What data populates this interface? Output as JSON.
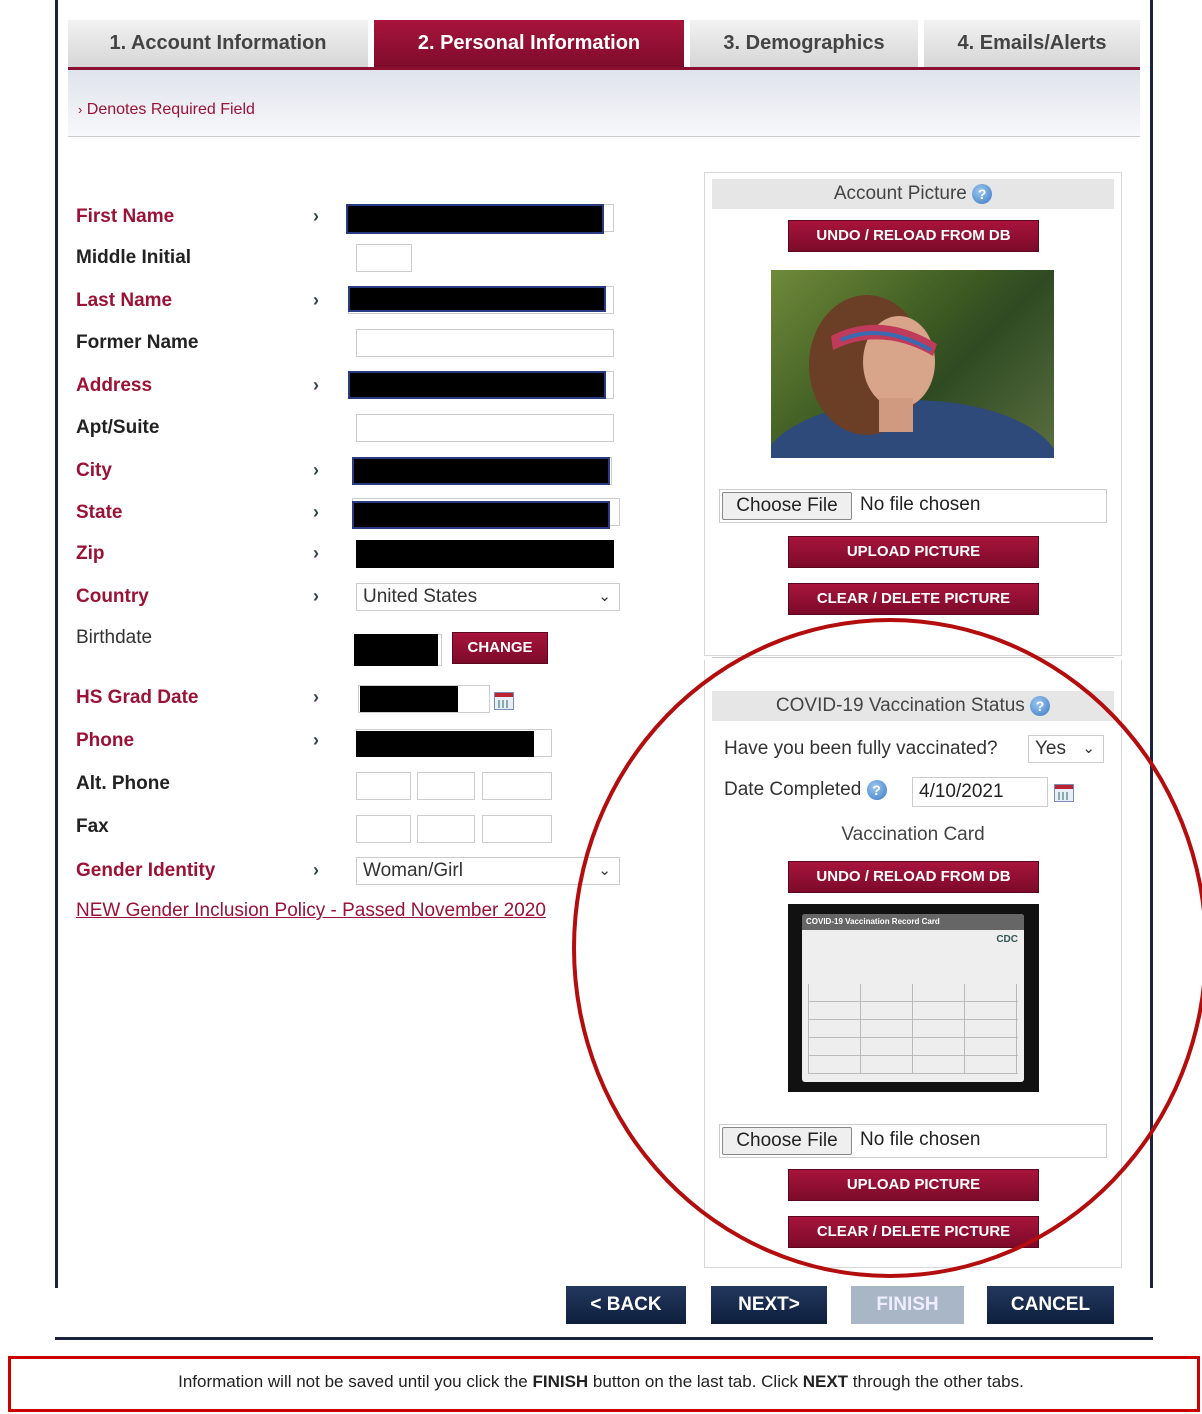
{
  "tabs": [
    {
      "label": "1. Account Information"
    },
    {
      "label": "2. Personal Information"
    },
    {
      "label": "3. Demographics"
    },
    {
      "label": "4. Emails/Alerts"
    }
  ],
  "required_note": "Denotes Required Field",
  "form": {
    "first_name": "First Name",
    "middle_initial": "Middle Initial",
    "last_name": "Last Name",
    "former_name": "Former Name",
    "address": "Address",
    "apt_suite": "Apt/Suite",
    "city": "City",
    "state": "State",
    "zip": "Zip",
    "country": "Country",
    "country_value": "United States",
    "birthdate": "Birthdate",
    "change_label": "CHANGE",
    "hs_grad_date": "HS Grad Date",
    "phone": "Phone",
    "alt_phone": "Alt. Phone",
    "fax": "Fax",
    "gender_identity": "Gender Identity",
    "gender_value": "Woman/Girl",
    "policy_link": "NEW Gender Inclusion Policy - Passed November 2020"
  },
  "account_picture": {
    "title": "Account Picture",
    "undo_label": "UNDO / RELOAD FROM DB",
    "choose_file": "Choose File",
    "no_file": "No file chosen",
    "upload_label": "UPLOAD PICTURE",
    "clear_label": "CLEAR / DELETE PICTURE"
  },
  "vaccination": {
    "title": "COVID-19 Vaccination Status",
    "question": "Have you been fully vaccinated?",
    "answer": "Yes",
    "date_label": "Date Completed",
    "date_value": "4/10/2021",
    "card_label": "Vaccination Card",
    "undo_label": "UNDO / RELOAD FROM DB",
    "card_image_title": "COVID-19 Vaccination Record Card",
    "card_logo": "CDC",
    "choose_file": "Choose File",
    "no_file": "No file chosen",
    "upload_label": "UPLOAD PICTURE",
    "clear_label": "CLEAR / DELETE PICTURE"
  },
  "nav": {
    "back": "< BACK",
    "next": "NEXT>",
    "finish": "FINISH",
    "cancel": "CANCEL"
  },
  "footer": {
    "part1": "Information will not be saved until you click the ",
    "finish": "FINISH",
    "part2": " button on the last tab. Click ",
    "next": "NEXT",
    "part3": " through the other tabs."
  },
  "icons": {
    "required_marker": "chevron-right-icon",
    "info": "info-icon",
    "calendar": "calendar-icon",
    "dropdown": "chevron-down-icon"
  },
  "colors": {
    "brand_maroon": "#8a0f30",
    "nav_navy": "#13274a",
    "annotation_red": "#b40d0d"
  }
}
